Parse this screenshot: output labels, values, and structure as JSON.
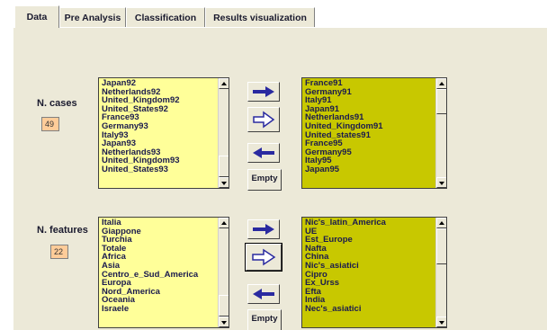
{
  "tabs": [
    {
      "label": "Data"
    },
    {
      "label": "Pre Analysis"
    },
    {
      "label": "Classification"
    },
    {
      "label": "Results visualization"
    }
  ],
  "cases": {
    "label": "N. cases",
    "count": "49",
    "available": [
      "Japan92",
      "Netherlands92",
      "United_Kingdom92",
      "United_States92",
      "France93",
      "Germany93",
      "Italy93",
      "Japan93",
      "Netherlands93",
      "United_Kingdom93",
      "United_States93"
    ],
    "selected": [
      "France91",
      "Germany91",
      "Italy91",
      "Japan91",
      "Netherlands91",
      "United_Kingdom91",
      "United_states91",
      "France95",
      "Germany95",
      "Italy95",
      "Japan95"
    ],
    "empty_label": "Empty"
  },
  "features": {
    "label": "N. features",
    "count": "22",
    "available": [
      "Italia",
      "Giappone",
      "Turchia",
      "Totale",
      "Africa",
      "Asia",
      "Centro_e_Sud_America",
      "Europa",
      "Nord_America",
      "Oceania",
      "Israele"
    ],
    "selected": [
      "Nic's_latin_America",
      "UE",
      "Est_Europe",
      "Nafta",
      "China",
      "Nic's_asiatici",
      "Cipro",
      "Ex_Urss",
      "Efta",
      "India",
      "Nec's_asiatici"
    ],
    "empty_label": "Empty"
  },
  "colors": {
    "available_list": "#ffff99",
    "selected_list": "#c8c800",
    "arrow": "#2a2aa0",
    "count_box": "#ffcc99"
  }
}
